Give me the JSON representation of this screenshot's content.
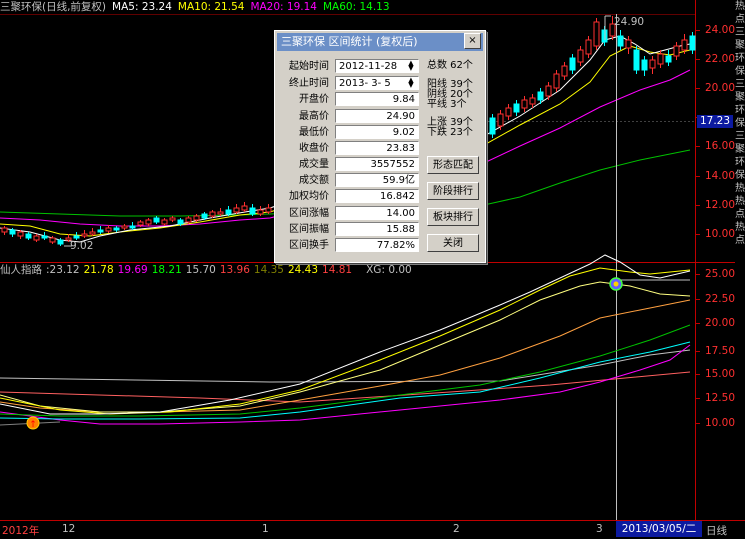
{
  "top_legend": {
    "title": "三聚环保(日线,前复权)",
    "ma5": "MA5: 23.24",
    "ma10": "MA10: 21.54",
    "ma20": "MA20: 19.14",
    "ma60": "MA60: 14.13",
    "colors": {
      "title": "#c0c0c0",
      "ma5": "#ffffff",
      "ma10": "#ffff00",
      "ma20": "#ff00ff",
      "ma60": "#00ff00"
    }
  },
  "price_axis": [
    "24.00",
    "22.00",
    "20.00",
    "18.00",
    "16.00",
    "14.00",
    "12.00",
    "10.00"
  ],
  "price_badge": "17.23",
  "high_label": "24.90",
  "low_label": "9.02",
  "indicator_legend": {
    "name": "仙人指路",
    "values": [
      "23.12",
      "21.78",
      "19.69",
      "18.21",
      "15.70",
      "13.96",
      "14.35",
      "24.43",
      "14.81"
    ],
    "colors": [
      "#c0c0c0",
      "#ffff00",
      "#ff00ff",
      "#00ff00",
      "#c0c0c0",
      "#ff4040",
      "#808000",
      "#ffff00",
      "#ff4040"
    ],
    "xg": "XG: 0.00"
  },
  "indicator_axis": [
    "25.00",
    "22.50",
    "20.00",
    "17.50",
    "15.00",
    "12.50",
    "10.00"
  ],
  "bottom_axis": {
    "labels": [
      "2012年",
      "12",
      "1",
      "2",
      "3"
    ],
    "cursor_date": "2013/03/05/二",
    "period_tab": "日线"
  },
  "right_strip_text": "热点三聚环保三聚环保三聚环保热热点热点",
  "dialog": {
    "title": "三聚环保  区间统计 (复权后)",
    "close": "×",
    "start_label": "起始时间",
    "start_value": "2012-11-28",
    "end_label": "终止时间",
    "end_value": "2013- 3- 5",
    "rows": [
      {
        "label": "开盘价",
        "value": "9.84"
      },
      {
        "label": "最高价",
        "value": "24.90"
      },
      {
        "label": "最低价",
        "value": "9.02"
      },
      {
        "label": "收盘价",
        "value": "23.83"
      },
      {
        "label": "成交量",
        "value": "3557552"
      },
      {
        "label": "成交额",
        "value": "59.9亿"
      },
      {
        "label": "加权均价",
        "value": "16.842"
      },
      {
        "label": "区间涨幅",
        "value": "14.00 (142.42%)"
      },
      {
        "label": "区间振幅",
        "value": "15.88 (176.05%)"
      },
      {
        "label": "区间换手",
        "value": "77.82%"
      }
    ],
    "stats": {
      "total": "总数  62个",
      "yang": "阳线  39个",
      "yin": "阴线  20个",
      "flat": "平线  3个",
      "up": "上涨  39个",
      "down": "下跌  23个"
    },
    "buttons": {
      "pattern": "形态匹配",
      "stage": "阶段排行",
      "sector": "板块排行",
      "close": "关闭"
    }
  }
}
